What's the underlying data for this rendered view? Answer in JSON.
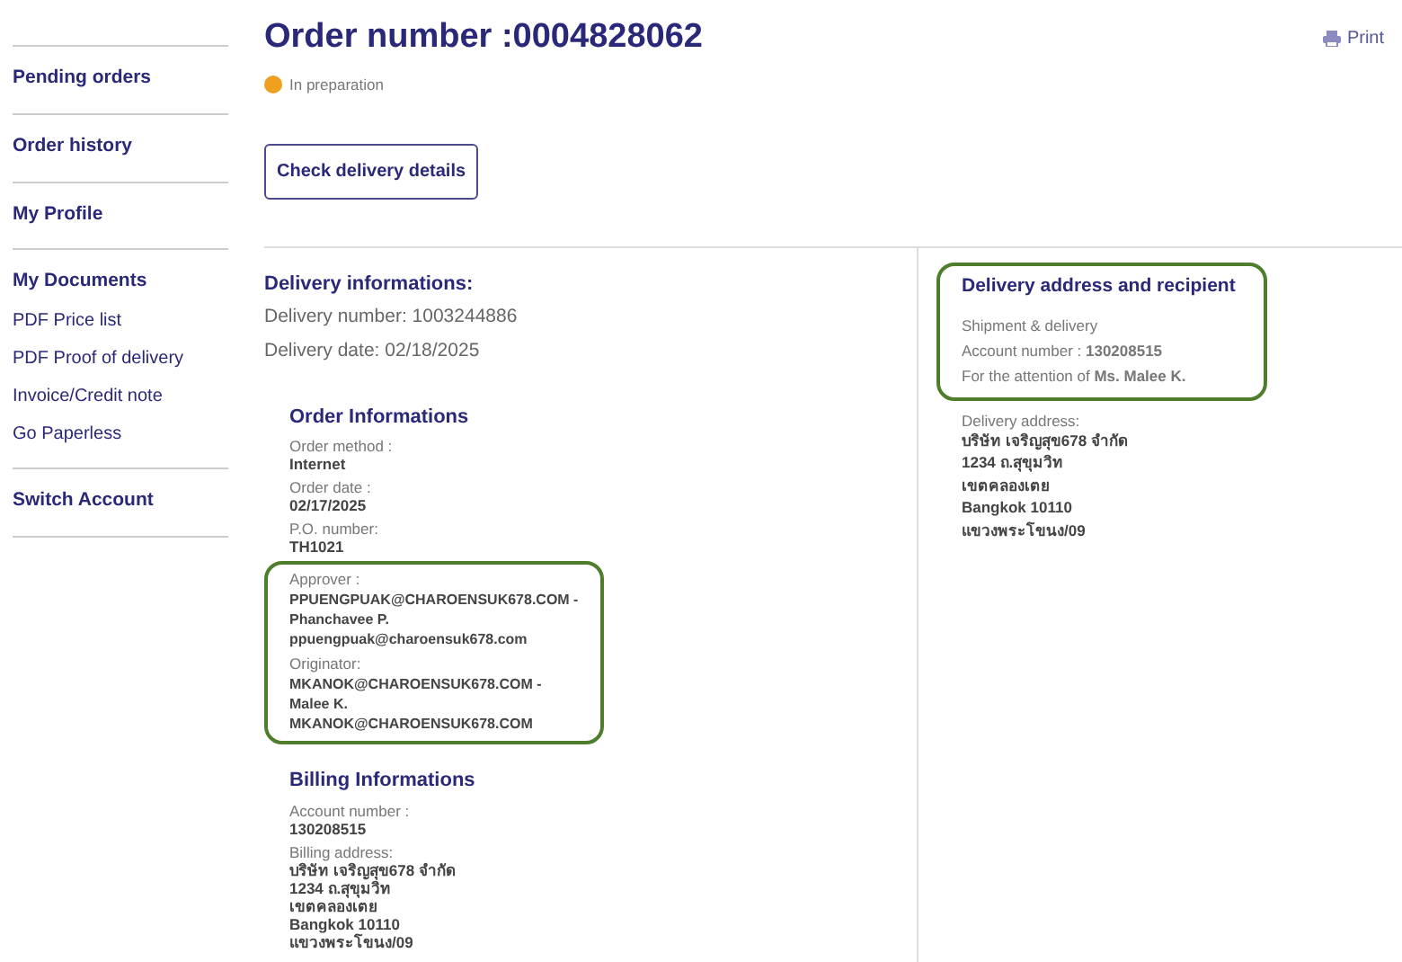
{
  "sidebar": {
    "sections": [
      {
        "title": "Pending orders"
      },
      {
        "title": "Order history"
      },
      {
        "title": "My Profile"
      },
      {
        "title": "My Documents",
        "links": [
          "PDF Price list",
          "PDF Proof of delivery",
          "Invoice/Credit note",
          "Go Paperless"
        ]
      },
      {
        "title": "Switch Account"
      }
    ]
  },
  "header": {
    "title": "Order number :0004828062",
    "print": "Print",
    "status": {
      "label": "In preparation",
      "color": "#f0a020"
    },
    "button": "Check delivery details"
  },
  "delivery_info": {
    "title": "Delivery informations:",
    "lines": [
      "Delivery number: 1003244886",
      "Delivery date: 02/18/2025"
    ]
  },
  "order_info": {
    "title": "Order Informations",
    "fields": [
      {
        "label": "Order method :",
        "values": [
          "Internet"
        ],
        "highlighted": false
      },
      {
        "label": "Order date :",
        "values": [
          "02/17/2025"
        ],
        "highlighted": false
      },
      {
        "label": "P.O. number:",
        "values": [
          "TH1021"
        ],
        "highlighted": false
      },
      {
        "label": "Approver :",
        "values": [
          "PPUENGPUAK@CHAROENSUK678.COM -",
          "Phanchavee P.",
          "ppuengpuak@charoensuk678.com"
        ],
        "highlighted": true
      },
      {
        "label": "Originator:",
        "values": [
          "MKANOK@CHAROENSUK678.COM -",
          "Malee K.",
          "MKANOK@CHAROENSUK678.COM"
        ],
        "highlighted": true
      }
    ]
  },
  "billing_info": {
    "title": "Billing Informations",
    "fields": [
      {
        "label": "Account number :",
        "values": [
          "130208515"
        ],
        "highlighted": false
      },
      {
        "label": "Billing address:",
        "values": [
          "บริษัท เจริญสุข678 จำกัด",
          "1234 ถ.สุขุมวิท",
          "เขตคลองเตย",
          "Bangkok 10110",
          "แขวงพระโขนง/09"
        ],
        "highlighted": false
      }
    ]
  },
  "recipient": {
    "title": "Delivery address and recipient",
    "highlighted": true,
    "lines": [
      "Shipment & delivery",
      "Account number : **130208515**",
      "For the attention of **Ms. Malee K.**"
    ]
  },
  "delivery_address": {
    "label": "Delivery address:",
    "values": [
      "บริษัท เจริญสุข678 จำกัด",
      "1234 ถ.สุขุมวิท",
      "เขตคลองเตย",
      "Bangkok 10110",
      "แขวงพระโขนง/09"
    ]
  }
}
